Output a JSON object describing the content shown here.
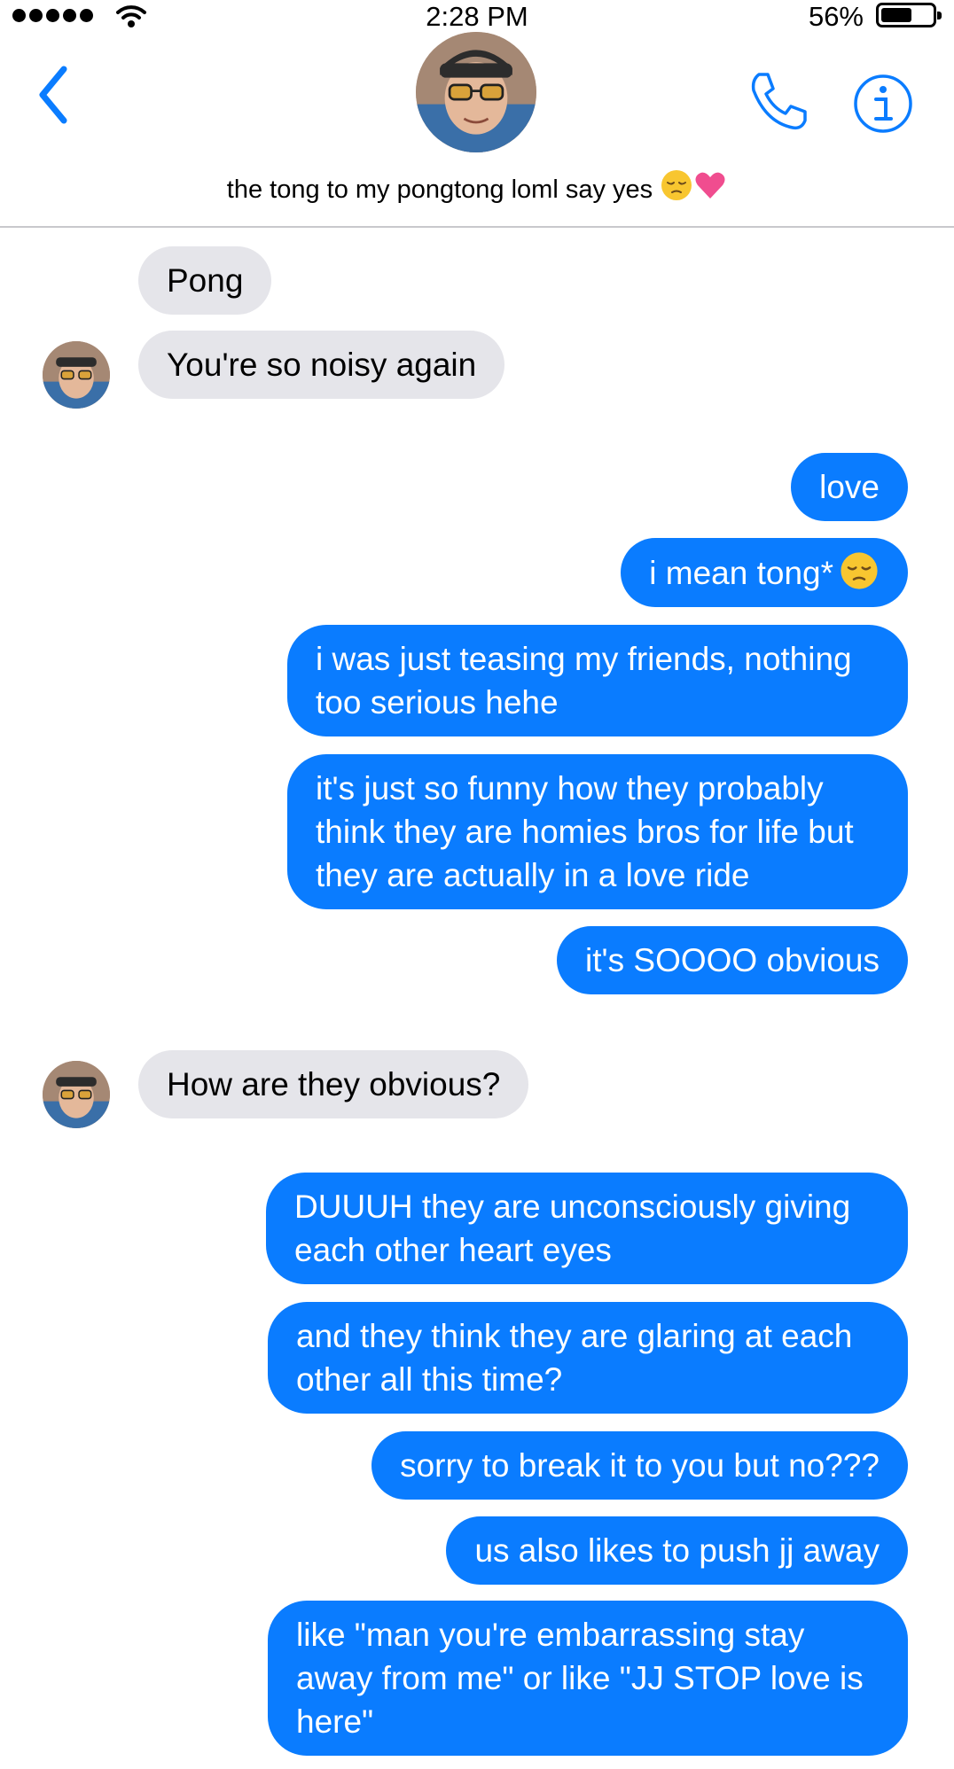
{
  "status_bar": {
    "time": "2:28 PM",
    "battery_percent": "56%",
    "signal_icon": "signal-dots-icon",
    "wifi_icon": "wifi-icon",
    "battery_icon": "battery-icon"
  },
  "header": {
    "contact_name": "the tong to my pongtong loml say yes",
    "back_icon": "chevron-left-icon",
    "call_icon": "phone-icon",
    "info_icon": "info-icon",
    "accent_color": "#0a7cff"
  },
  "messages": [
    {
      "from": "them",
      "text": "Pong"
    },
    {
      "from": "them",
      "text": "You're so noisy again"
    },
    {
      "from": "me",
      "text": "love"
    },
    {
      "from": "me",
      "text": "i mean tong*"
    },
    {
      "from": "me",
      "text": "i was just teasing my friends, nothing too serious hehe"
    },
    {
      "from": "me",
      "text": "it's just so funny how they probably think they are homies bros for life but they are actually in a love ride"
    },
    {
      "from": "me",
      "text": "it's SOOOO obvious"
    },
    {
      "from": "them",
      "text": "How are they obvious?"
    },
    {
      "from": "me",
      "text": "DUUUH they are unconsciously giving each other heart eyes"
    },
    {
      "from": "me",
      "text": "and they think they are glaring at each other all this time?"
    },
    {
      "from": "me",
      "text": "sorry to break it to you but no???"
    },
    {
      "from": "me",
      "text": "us also likes to push jj away"
    },
    {
      "from": "me",
      "text": "like \"man you're embarrassing stay away from me\" or like \"JJ STOP love is here\""
    }
  ],
  "colors": {
    "outgoing_bubble": "#0a7cff",
    "incoming_bubble": "#e5e5ea"
  }
}
